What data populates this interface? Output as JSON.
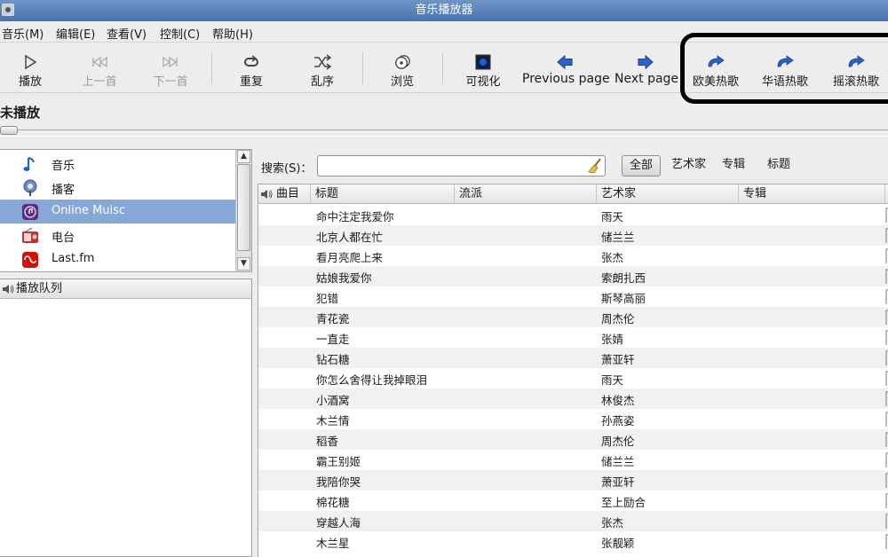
{
  "window": {
    "title": "音乐播放器"
  },
  "menu": [
    "音乐(M)",
    "编辑(E)",
    "查看(V)",
    "控制(C)",
    "帮助(H)"
  ],
  "toolbar": {
    "play": "播放",
    "prev": "上一首",
    "next": "下一首",
    "repeat": "重复",
    "shuffle": "乱序",
    "browse": "浏览",
    "visualize": "可视化",
    "prev_page": "Previous page",
    "next_page": "Next page",
    "hot_western": "欧美热歌",
    "hot_chinese": "华语热歌",
    "hot_rock": "摇滚热歌"
  },
  "status": "未播放",
  "sources": [
    {
      "label": "音乐",
      "icon": "music-note-icon",
      "selected": false
    },
    {
      "label": "播客",
      "icon": "podcast-icon",
      "selected": false
    },
    {
      "label": "Online Muisc",
      "icon": "online-music-icon",
      "selected": true
    },
    {
      "label": "电台",
      "icon": "radio-icon",
      "selected": false
    },
    {
      "label": "Last.fm",
      "icon": "lastfm-icon",
      "selected": false
    }
  ],
  "queue": {
    "title": "播放队列"
  },
  "search": {
    "label": "搜索(S)：",
    "value": ""
  },
  "filters": {
    "all": "全部",
    "artist": "艺术家",
    "album": "专辑",
    "title": "标题"
  },
  "columns": {
    "track": "曲目",
    "title": "标题",
    "genre": "流派",
    "artist": "艺术家",
    "album": "专辑"
  },
  "songs": [
    {
      "title": "命中注定我爱你",
      "artist": "雨天"
    },
    {
      "title": "北京人都在忙",
      "artist": "储兰兰"
    },
    {
      "title": "看月亮爬上来",
      "artist": "张杰"
    },
    {
      "title": "姑娘我爱你",
      "artist": "索朗扎西"
    },
    {
      "title": "犯错",
      "artist": "斯琴高丽"
    },
    {
      "title": "青花瓷",
      "artist": "周杰伦"
    },
    {
      "title": "一直走",
      "artist": "张婧"
    },
    {
      "title": "钻石糖",
      "artist": "萧亚轩"
    },
    {
      "title": "你怎么舍得让我掉眼泪",
      "artist": "雨天"
    },
    {
      "title": "小酒窝",
      "artist": "林俊杰"
    },
    {
      "title": "木兰情",
      "artist": "孙燕姿"
    },
    {
      "title": "稻香",
      "artist": "周杰伦"
    },
    {
      "title": "霸王别姬",
      "artist": "储兰兰"
    },
    {
      "title": "我陪你哭",
      "artist": "萧亚轩"
    },
    {
      "title": "棉花糖",
      "artist": "至上励合"
    },
    {
      "title": "穿越人海",
      "artist": "张杰"
    },
    {
      "title": "木兰星",
      "artist": "张靓颖"
    }
  ]
}
